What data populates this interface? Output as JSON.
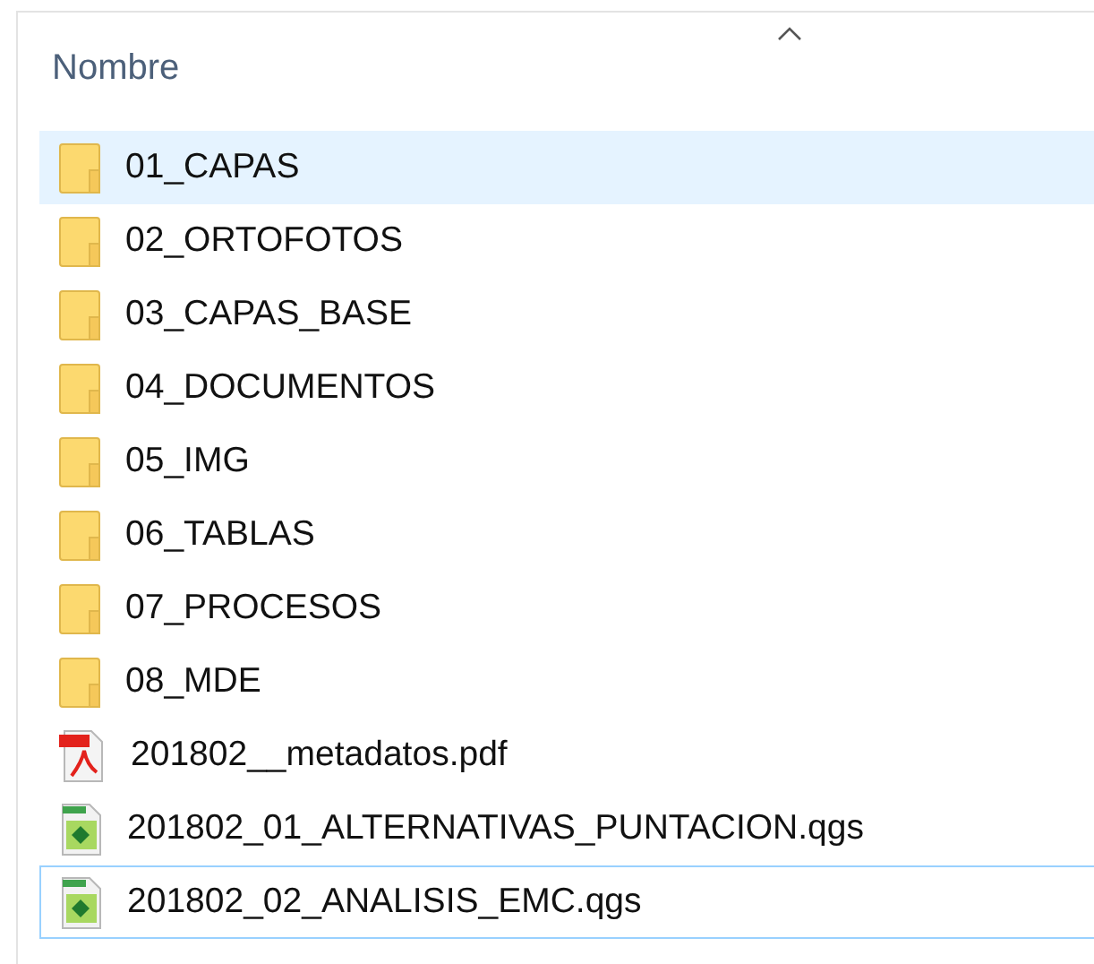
{
  "header": {
    "column": "Nombre",
    "sorted_ascending": true
  },
  "files": [
    {
      "name": "01_CAPAS",
      "kind": "folder",
      "hovered": true,
      "focused": false
    },
    {
      "name": "02_ORTOFOTOS",
      "kind": "folder",
      "hovered": false,
      "focused": false
    },
    {
      "name": "03_CAPAS_BASE",
      "kind": "folder",
      "hovered": false,
      "focused": false
    },
    {
      "name": "04_DOCUMENTOS",
      "kind": "folder",
      "hovered": false,
      "focused": false
    },
    {
      "name": "05_IMG",
      "kind": "folder",
      "hovered": false,
      "focused": false
    },
    {
      "name": "06_TABLAS",
      "kind": "folder",
      "hovered": false,
      "focused": false
    },
    {
      "name": "07_PROCESOS",
      "kind": "folder",
      "hovered": false,
      "focused": false
    },
    {
      "name": "08_MDE",
      "kind": "folder",
      "hovered": false,
      "focused": false
    },
    {
      "name": "201802__metadatos.pdf",
      "kind": "pdf",
      "hovered": false,
      "focused": false
    },
    {
      "name": "201802_01_ALTERNATIVAS_PUNTACION.qgs",
      "kind": "qgs",
      "hovered": false,
      "focused": false
    },
    {
      "name": "201802_02_ANALISIS_EMC.qgs",
      "kind": "qgs",
      "hovered": false,
      "focused": true
    }
  ]
}
